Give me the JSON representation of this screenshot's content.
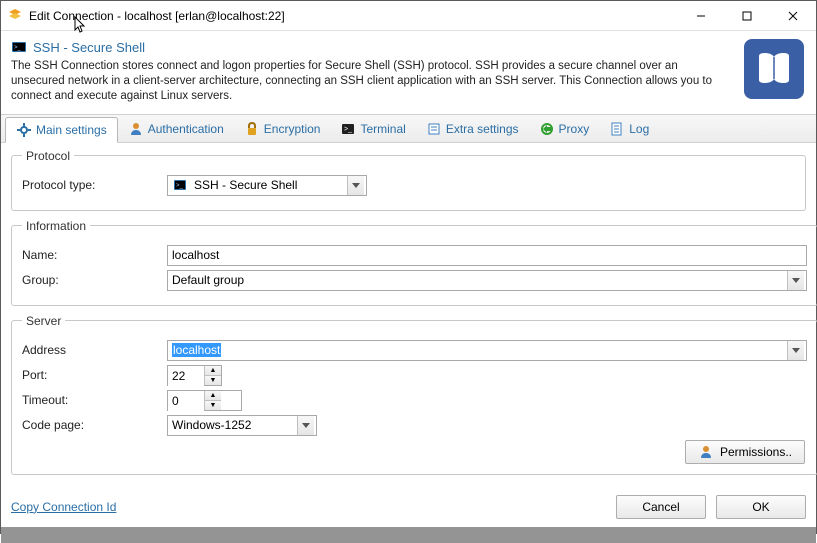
{
  "window": {
    "title": "Edit Connection - localhost [erlan@localhost:22]"
  },
  "header": {
    "title": "SSH - Secure Shell",
    "description": "The SSH Connection stores connect and logon properties for Secure Shell (SSH) protocol. SSH provides a secure channel over an unsecured network in a client-server architecture, connecting an SSH client application with an SSH server. This Connection allows you to connect and execute against Linux servers."
  },
  "tabs": [
    {
      "label": "Main settings",
      "icon": "settings-icon"
    },
    {
      "label": "Authentication",
      "icon": "user-icon"
    },
    {
      "label": "Encryption",
      "icon": "lock-icon"
    },
    {
      "label": "Terminal",
      "icon": "terminal-icon"
    },
    {
      "label": "Extra settings",
      "icon": "extra-icon"
    },
    {
      "label": "Proxy",
      "icon": "proxy-icon"
    },
    {
      "label": "Log",
      "icon": "log-icon"
    }
  ],
  "protocol": {
    "legend": "Protocol",
    "type_label": "Protocol type:",
    "type_value": "SSH - Secure Shell"
  },
  "information": {
    "legend": "Information",
    "name_label": "Name:",
    "name_value": "localhost",
    "group_label": "Group:",
    "group_value": "Default group"
  },
  "server": {
    "legend": "Server",
    "address_label": "Address",
    "address_value": "localhost",
    "port_label": "Port:",
    "port_value": "22",
    "timeout_label": "Timeout:",
    "timeout_value": "0",
    "codepage_label": "Code page:",
    "codepage_value": "Windows-1252"
  },
  "actions": {
    "permissions": "Permissions..",
    "copy_id": "Copy Connection Id",
    "cancel": "Cancel",
    "ok": "OK"
  }
}
